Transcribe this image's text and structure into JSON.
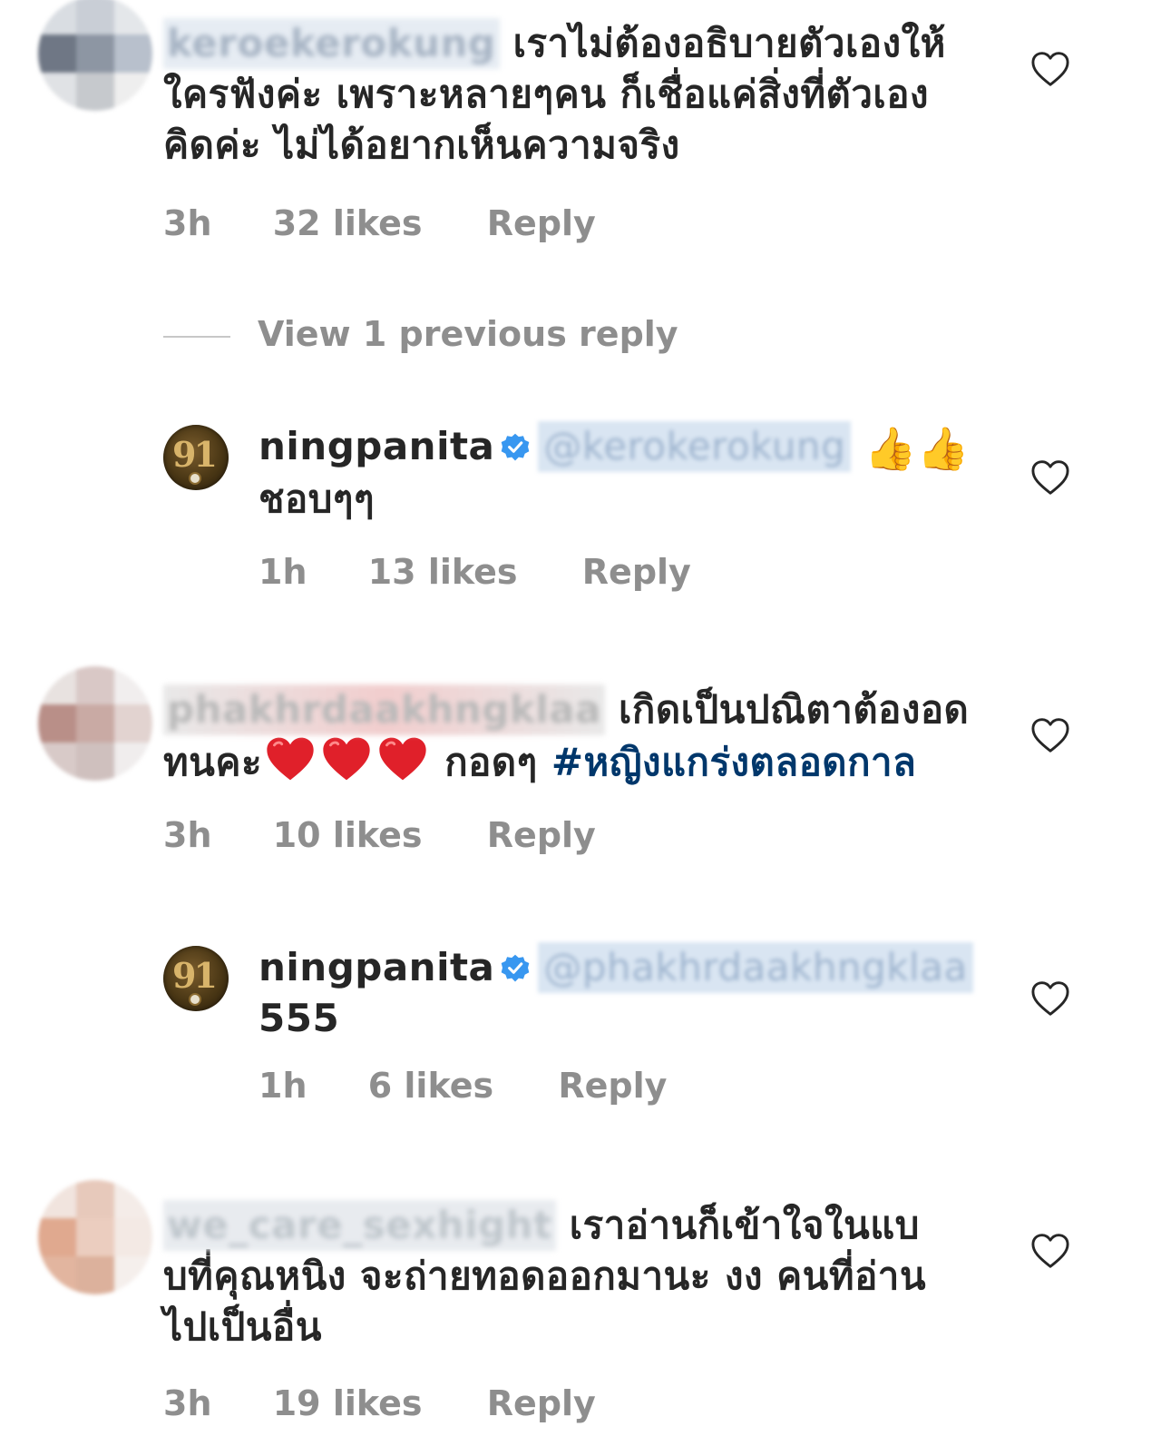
{
  "comments": [
    {
      "username": "keroekerokung",
      "body_line1": "เราไม่ต้องอธิบายตัวเองให้",
      "body_line2": "ใครฟังค่ะ เพราะหลายๆคน ก็เชื่อแค่สิ่งที่ตัวเอง",
      "body_line3": "คิดค่ะ ไม่ได้อยากเห็นความจริง",
      "time": "3h",
      "likes": "32 likes",
      "reply": "Reply"
    },
    {
      "username": "phakhrdaakhngklaa",
      "body_line1": "เกิดเป็นปณิตาต้องอด",
      "body_line2_text": "ทนคะ",
      "body_line2_after": "กอดๆ",
      "hashtag": "#หญิงแกร่งตลอดกาล",
      "time": "3h",
      "likes": "10 likes",
      "reply": "Reply"
    },
    {
      "username": "we_care_sexhight",
      "body_line1": "เราอ่านก็เข้าใจในแบ",
      "body_line2": "บที่คุณหนิง จะถ่ายทอดออกมานะ งง คนที่อ่าน",
      "body_line3": "ไปเป็นอื่น",
      "time": "3h",
      "likes": "19 likes",
      "reply": "Reply"
    }
  ],
  "view_previous": "View 1 previous reply",
  "replies": [
    {
      "username": "ningpanita",
      "avatar_text": "91",
      "mention": "@kerokerokung",
      "emoji": "👍👍",
      "body": "ชอบๆๆ",
      "time": "1h",
      "likes": "13 likes",
      "reply": "Reply"
    },
    {
      "username": "ningpanita",
      "avatar_text": "91",
      "mention": "@phakhrdaakhngklaa",
      "body": "555",
      "time": "1h",
      "likes": "6 likes",
      "reply": "Reply"
    }
  ],
  "icons": {
    "like": "heart-outline-icon",
    "verified": "verified-badge-icon",
    "heart_emoji": "red-heart-emoji"
  },
  "colors": {
    "text": "#262626",
    "meta": "#8e8e8e",
    "hashtag": "#00376b",
    "verified": "#3897f0",
    "heart": "#e0202a"
  }
}
